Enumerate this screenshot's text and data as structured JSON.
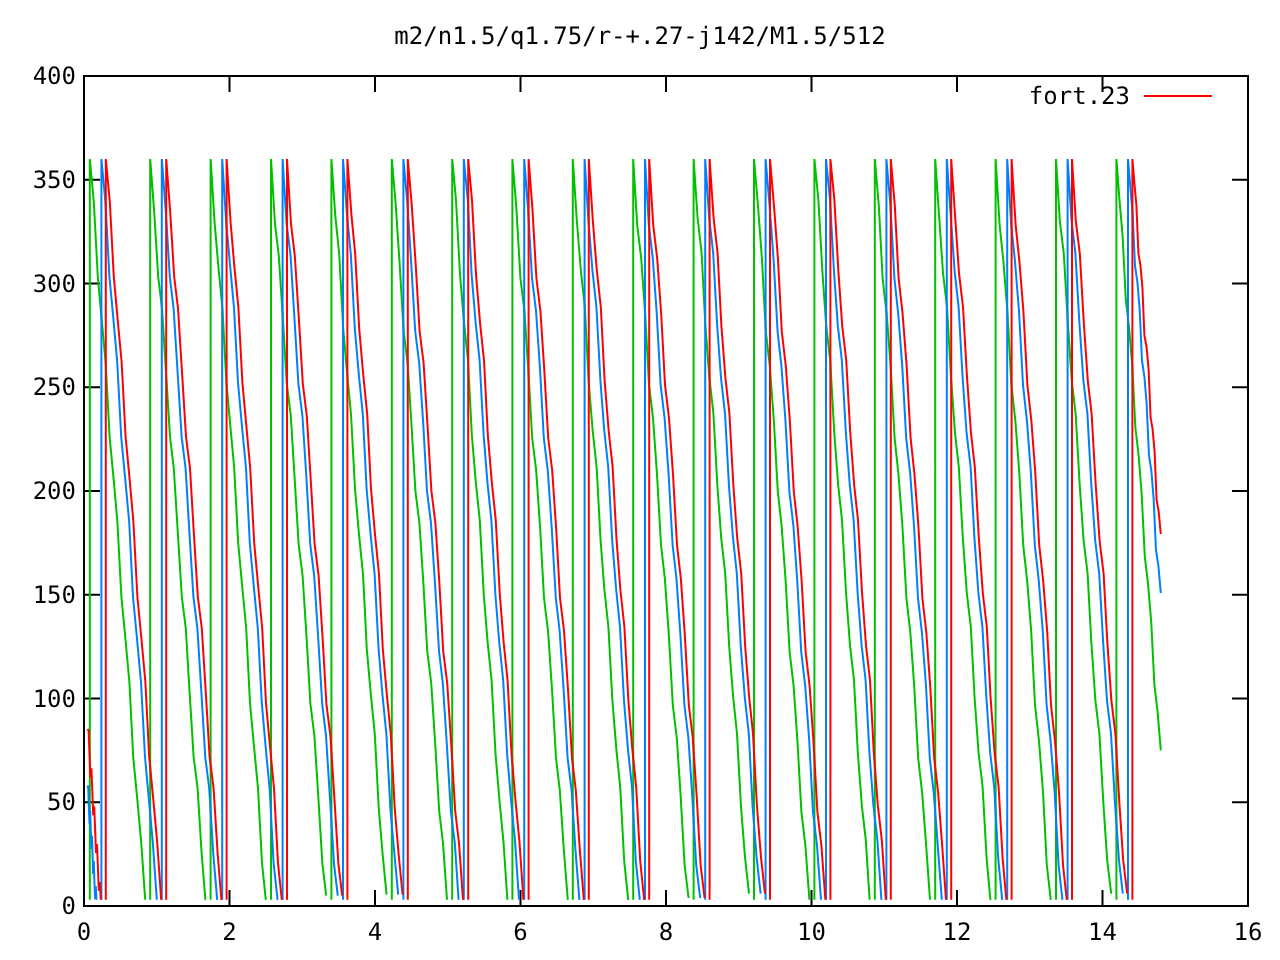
{
  "plot": {
    "title": "m2/n1.5/q1.75/r-+.27-j142/M1.5/512",
    "legend": [
      {
        "label": "fort.23"
      }
    ],
    "y_ticks": [
      "400",
      "350",
      "300",
      "250",
      "200",
      "150",
      "100",
      "50",
      "0"
    ],
    "x_ticks": [
      "0",
      "2",
      "4",
      "6",
      "8",
      "10",
      "12",
      "14",
      "16"
    ]
  }
}
